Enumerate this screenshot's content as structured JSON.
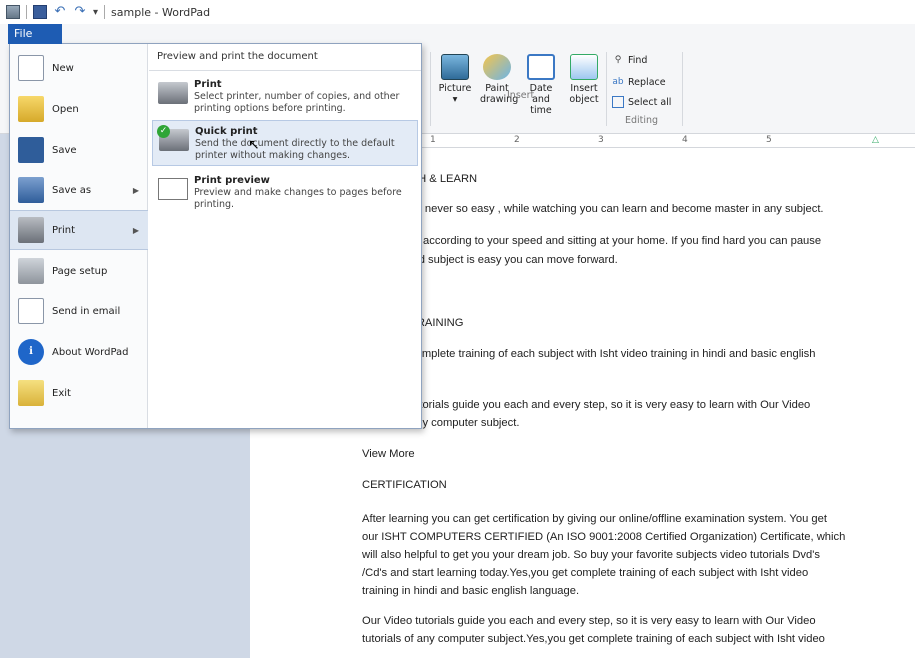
{
  "window": {
    "title": "sample - WordPad"
  },
  "ribbon": {
    "file_tab": "File",
    "insert": {
      "picture": "Picture",
      "paint": "Paint drawing",
      "datetime": "Date and time",
      "object": "Insert object",
      "label": "Insert"
    },
    "editing": {
      "find": "Find",
      "replace": "Replace",
      "select_all": "Select all",
      "label": "Editing"
    }
  },
  "ruler": {
    "marks": [
      "1",
      "2",
      "3",
      "4",
      "5"
    ]
  },
  "file_menu": {
    "items": [
      {
        "label": "New",
        "icon": "new-document-icon",
        "submenu": false
      },
      {
        "label": "Open",
        "icon": "open-folder-icon",
        "submenu": false
      },
      {
        "label": "Save",
        "icon": "save-icon",
        "submenu": false
      },
      {
        "label": "Save as",
        "icon": "save-as-icon",
        "submenu": true
      },
      {
        "label": "Print",
        "icon": "printer-icon",
        "submenu": true
      },
      {
        "label": "Page setup",
        "icon": "page-setup-icon",
        "submenu": false
      },
      {
        "label": "Send in email",
        "icon": "email-icon",
        "submenu": false
      },
      {
        "label": "About WordPad",
        "icon": "info-icon",
        "submenu": false
      },
      {
        "label": "Exit",
        "icon": "exit-icon",
        "submenu": false
      }
    ],
    "submenu": {
      "header": "Preview and print the document",
      "items": [
        {
          "title": "Print",
          "desc": "Select printer, number of copies, and other printing options before printing."
        },
        {
          "title": "Quick print",
          "desc": "Send the document directly to the default printer without making changes."
        },
        {
          "title": "Print preview",
          "desc": "Preview and make changes to pages before printing."
        }
      ]
    }
  },
  "document": {
    "lines": [
      "CH & LEARN",
      "as never so easy , while watching you can learn and become master in any subject.",
      "rn according to your speed and sitting at your home. If you find hard you can pause",
      "ind subject is easy you can move forward.",
      "TRAINING",
      "complete training of each subject with Isht video training in hindi and basic english",
      "tutorials guide you each and every step, so it is very easy to learn with Our Video",
      "any computer subject.",
      "View More",
      "CERTIFICATION",
      "After learning you can get certification by giving our online/offline examination system. You get",
      "our ISHT COMPUTERS CERTIFIED (An ISO 9001:2008  Certified Organization) Certificate, which",
      "will also helpful to get you your dream job. So buy your favorite subjects video tutorials Dvd's",
      "/Cd's and start learning today.Yes,you get complete training of each subject with Isht video",
      "training in hindi and basic english language.",
      "Our Video tutorials guide you each and every step, so it is very easy to learn with Our Video",
      "tutorials of any computer subject.Yes,you get complete training of each subject with Isht video"
    ]
  }
}
